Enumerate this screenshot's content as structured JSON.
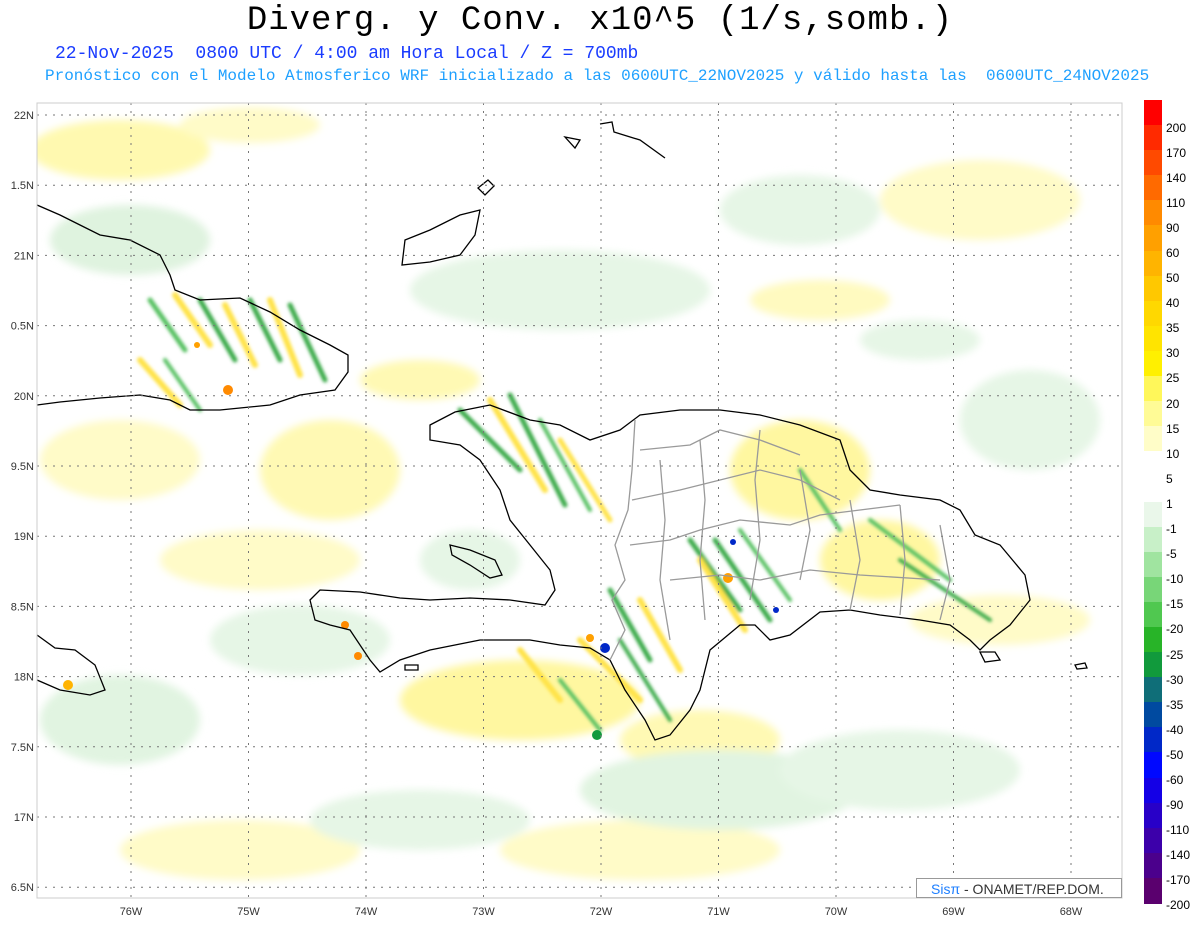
{
  "header": {
    "title": "Diverg. y Conv. x10^5 (1/s,somb.)",
    "line1": "22-Nov-2025  0800 UTC / 4:00 am Hora Local / Z = 700mb",
    "line2": "Pronóstico con el Modelo Atmosferico WRF inicializado a las 0600UTC_22NOV2025 y válido hasta las  0600UTC_24NOV2025"
  },
  "map": {
    "lat_labels": [
      "22N",
      "1.5N",
      "21N",
      "0.5N",
      "20N",
      "9.5N",
      "19N",
      "8.5N",
      "18N",
      "7.5N",
      "17N",
      "6.5N"
    ],
    "lon_labels": [
      "76W",
      "75W",
      "74W",
      "73W",
      "72W",
      "71W",
      "70W",
      "69W",
      "68W"
    ]
  },
  "legend": {
    "labels": [
      "200",
      "170",
      "140",
      "110",
      "90",
      "60",
      "50",
      "40",
      "35",
      "30",
      "25",
      "20",
      "15",
      "10",
      "5",
      "1",
      "-1",
      "-5",
      "-10",
      "-15",
      "-20",
      "-25",
      "-30",
      "-35",
      "-40",
      "-50",
      "-60",
      "-90",
      "-110",
      "-140",
      "-170",
      "-200"
    ],
    "colors": [
      "#ff0000",
      "#ff2a00",
      "#ff4a00",
      "#ff6a00",
      "#ff8a00",
      "#ffa000",
      "#ffb400",
      "#ffc800",
      "#ffd800",
      "#ffe400",
      "#fff000",
      "#fff75a",
      "#fffb96",
      "#fffdc8",
      "#ffffff",
      "#ffffff",
      "#eaf7ea",
      "#c8f0c8",
      "#a0e4a0",
      "#78d678",
      "#50c850",
      "#28b428",
      "#119a3c",
      "#0f6e78",
      "#004aa0",
      "#0028c8",
      "#0008ff",
      "#1400e6",
      "#2800c8",
      "#3c00aa",
      "#4b008c",
      "#5a006e"
    ]
  },
  "credit": {
    "part1": "Sisπ",
    "part2": " - ONAMET/REP.DOM."
  },
  "colors": {
    "land_outline": "#000000",
    "province_outline": "#999999",
    "grid": "#888888",
    "pos": "#ffe84a",
    "neg": "#4cc05c"
  }
}
